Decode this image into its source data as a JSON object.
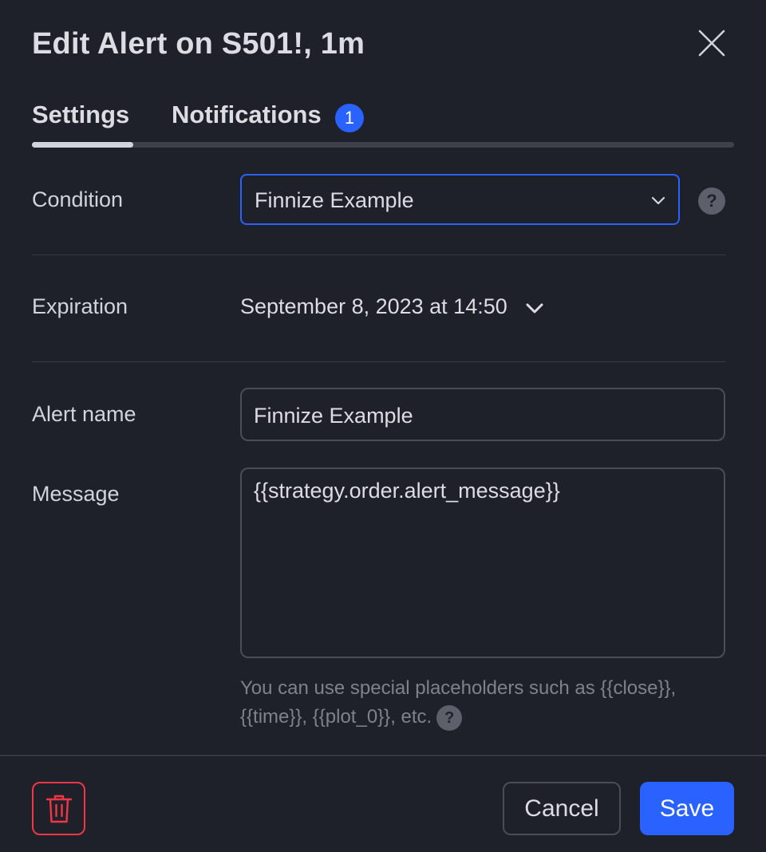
{
  "dialog": {
    "title": "Edit Alert on S501!, 1m"
  },
  "tabs": [
    {
      "label": "Settings",
      "active": true
    },
    {
      "label": "Notifications",
      "badge": "1"
    }
  ],
  "condition": {
    "label": "Condition",
    "value": "Finnize Example"
  },
  "expiration": {
    "label": "Expiration",
    "value": "September 8, 2023 at 14:50"
  },
  "alert_name": {
    "label": "Alert name",
    "value": "Finnize Example"
  },
  "message": {
    "label": "Message",
    "value": "{{strategy.order.alert_message}}",
    "hint": "You can use special placeholders such as {{close}}, {{time}}, {{plot_0}}, etc."
  },
  "help_glyph": "?",
  "footer": {
    "cancel_label": "Cancel",
    "save_label": "Save"
  },
  "colors": {
    "background": "#1e202a",
    "accent": "#2962ff",
    "danger": "#f23645"
  },
  "icons": {
    "close": "close-icon",
    "dropdown": "chevron-down-icon",
    "help": "question-icon",
    "delete": "trash-icon"
  }
}
